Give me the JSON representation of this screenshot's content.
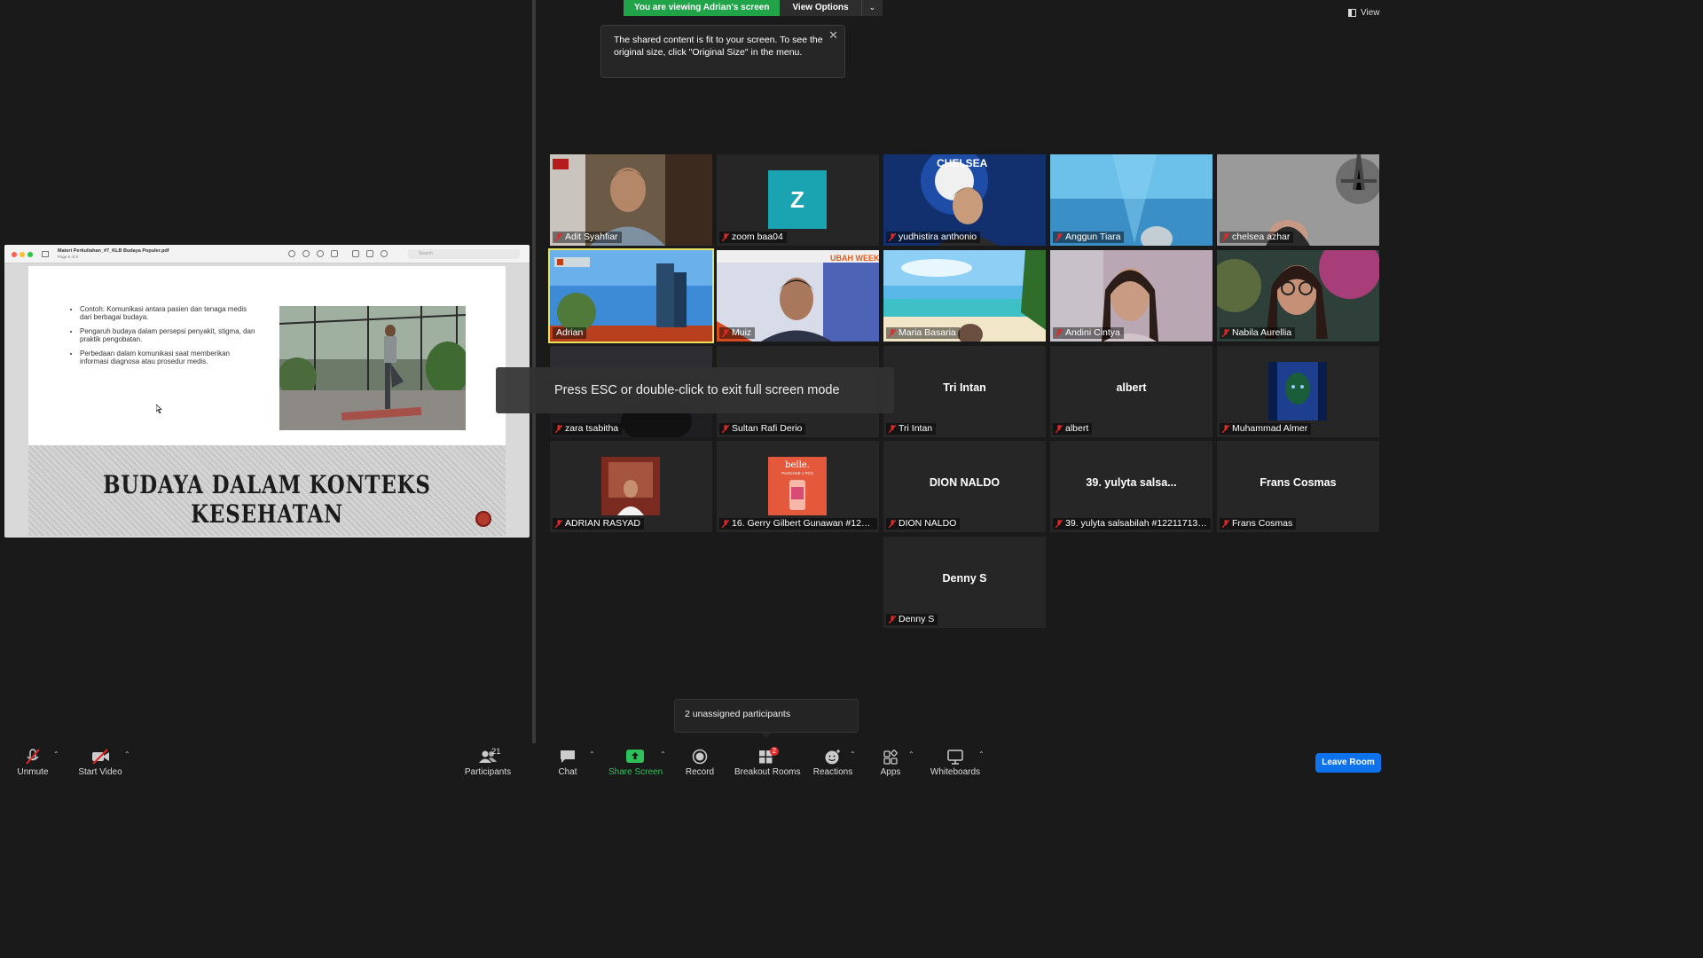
{
  "banner": {
    "viewing": "You are viewing Adrian's screen",
    "view_options": "View Options"
  },
  "tooltip": {
    "text": "The shared content is fit to your screen. To see the original size, click \"Original Size\" in the menu."
  },
  "view_label": "View",
  "fullscreen_toast": "Press ESC or double-click to exit full screen mode",
  "shared_pdf": {
    "title": "Materi Perkuliahan_#7_KLB Budaya Populer.pdf",
    "page": "Page 6 of 8",
    "search_placeholder": "Search",
    "bullets": [
      "Contoh: Komunikasi antara pasien dan tenaga medis dari berbagai budaya.",
      "Pengaruh budaya dalam persepsi penyakit, stigma, dan praktik pengobatan.",
      "Perbedaan dalam komunikasi saat memberikan informasi diagnosa atau prosedur medis."
    ],
    "heading": "BUDAYA DALAM KONTEKS KESEHATAN"
  },
  "participants": [
    {
      "name": "Adit Syahfiar",
      "type": "video"
    },
    {
      "name": "zoom baa04",
      "type": "letter",
      "letter": "Z",
      "color": "#1aa3b0"
    },
    {
      "name": "yudhistira anthonio",
      "type": "video"
    },
    {
      "name": "Anggun Tiara",
      "type": "video"
    },
    {
      "name": "chelsea azhar",
      "type": "video"
    },
    {
      "name": "Adrian",
      "type": "video",
      "active": true
    },
    {
      "name": "Muiz",
      "type": "video"
    },
    {
      "name": "Maria Basaria",
      "type": "video"
    },
    {
      "name": "Andini Cintya",
      "type": "video"
    },
    {
      "name": "Nabila Aurellia",
      "type": "video"
    },
    {
      "name": "zara tsabitha",
      "type": "video"
    },
    {
      "name": "Sultan Rafi Derio",
      "type": "blank"
    },
    {
      "name": "Tri Intan",
      "type": "text",
      "display": "Tri Intan"
    },
    {
      "name": "albert",
      "type": "text",
      "display": "albert"
    },
    {
      "name": "Muhammad Almer",
      "type": "avatar"
    },
    {
      "name": "ADRIAN RASYAD",
      "type": "avatar"
    },
    {
      "name": "16. Gerry Gilbert Gunawan #122...",
      "type": "avatar",
      "avatar_text": "belle."
    },
    {
      "name": "DION NALDO",
      "type": "text",
      "display": "DION NALDO"
    },
    {
      "name": "39. yulyta salsabilah #122117130...",
      "type": "text",
      "display": "39. yulyta salsa..."
    },
    {
      "name": "Frans Cosmas",
      "type": "text",
      "display": "Frans Cosmas"
    },
    {
      "name": "Denny S",
      "type": "text",
      "display": "Denny S"
    }
  ],
  "unassigned_popup": "2 unassigned participants",
  "toolbar": {
    "unmute": "Unmute",
    "start_video": "Start Video",
    "participants": "Participants",
    "participants_count": "21",
    "chat": "Chat",
    "share_screen": "Share Screen",
    "record": "Record",
    "breakout_rooms": "Breakout Rooms",
    "breakout_badge": "2",
    "reactions": "Reactions",
    "apps": "Apps",
    "whiteboards": "Whiteboards",
    "leave_room": "Leave Room"
  },
  "colors": {
    "banner_green": "#21a34a",
    "leave_blue": "#0e72ed",
    "active_border": "#e8e35a",
    "share_green": "#2ec15b",
    "mute_red": "#e02828"
  }
}
